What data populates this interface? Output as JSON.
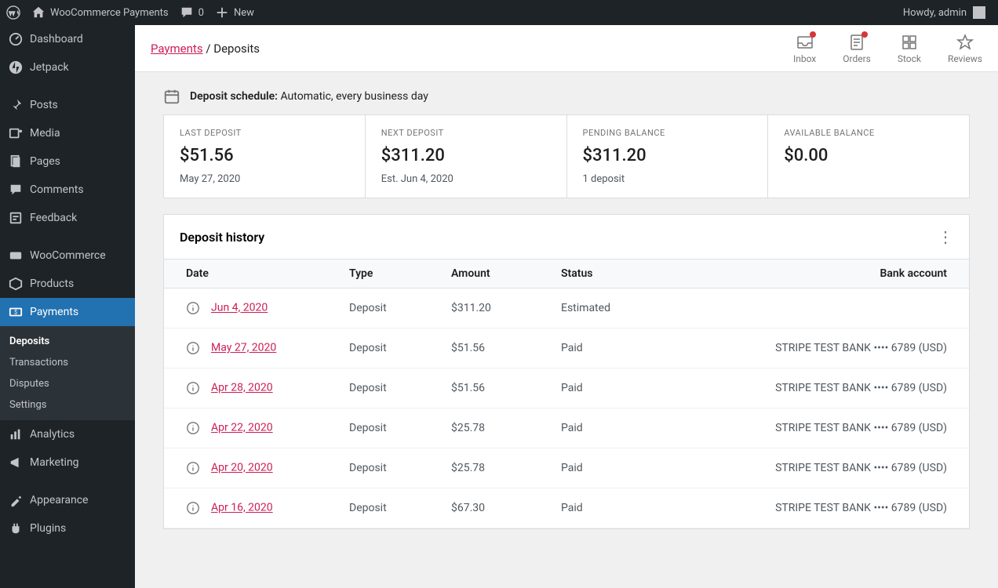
{
  "adminbar": {
    "site_name": "WooCommerce Payments",
    "comments": "0",
    "new_label": "New",
    "howdy": "Howdy, admin"
  },
  "sidebar": {
    "items": [
      {
        "label": "Dashboard"
      },
      {
        "label": "Jetpack"
      },
      {
        "label": "Posts"
      },
      {
        "label": "Media"
      },
      {
        "label": "Pages"
      },
      {
        "label": "Comments"
      },
      {
        "label": "Feedback"
      },
      {
        "label": "WooCommerce"
      },
      {
        "label": "Products"
      },
      {
        "label": "Payments"
      },
      {
        "label": "Analytics"
      },
      {
        "label": "Marketing"
      },
      {
        "label": "Appearance"
      },
      {
        "label": "Plugins"
      }
    ],
    "submenu": [
      {
        "label": "Deposits",
        "current": true
      },
      {
        "label": "Transactions"
      },
      {
        "label": "Disputes"
      },
      {
        "label": "Settings"
      }
    ]
  },
  "header": {
    "breadcrumb_parent": "Payments",
    "breadcrumb_current": "Deposits",
    "actions": [
      {
        "label": "Inbox",
        "dot": true
      },
      {
        "label": "Orders",
        "dot": true
      },
      {
        "label": "Stock",
        "dot": false
      },
      {
        "label": "Reviews",
        "dot": false
      }
    ]
  },
  "schedule": {
    "label": "Deposit schedule:",
    "value": "Automatic, every business day"
  },
  "summary": [
    {
      "label": "LAST DEPOSIT",
      "value": "$51.56",
      "sub": "May 27, 2020"
    },
    {
      "label": "NEXT DEPOSIT",
      "value": "$311.20",
      "sub": "Est. Jun 4, 2020"
    },
    {
      "label": "PENDING BALANCE",
      "value": "$311.20",
      "sub": "1 deposit"
    },
    {
      "label": "AVAILABLE BALANCE",
      "value": "$0.00",
      "sub": ""
    }
  ],
  "table": {
    "title": "Deposit history",
    "columns": [
      "Date",
      "Type",
      "Amount",
      "Status",
      "Bank account"
    ],
    "rows": [
      {
        "date": "Jun 4, 2020",
        "type": "Deposit",
        "amount": "$311.20",
        "status": "Estimated",
        "bank": ""
      },
      {
        "date": "May 27, 2020",
        "type": "Deposit",
        "amount": "$51.56",
        "status": "Paid",
        "bank": "STRIPE TEST BANK •••• 6789 (USD)"
      },
      {
        "date": "Apr 28, 2020",
        "type": "Deposit",
        "amount": "$51.56",
        "status": "Paid",
        "bank": "STRIPE TEST BANK •••• 6789 (USD)"
      },
      {
        "date": "Apr 22, 2020",
        "type": "Deposit",
        "amount": "$25.78",
        "status": "Paid",
        "bank": "STRIPE TEST BANK •••• 6789 (USD)"
      },
      {
        "date": "Apr 20, 2020",
        "type": "Deposit",
        "amount": "$25.78",
        "status": "Paid",
        "bank": "STRIPE TEST BANK •••• 6789 (USD)"
      },
      {
        "date": "Apr 16, 2020",
        "type": "Deposit",
        "amount": "$67.30",
        "status": "Paid",
        "bank": "STRIPE TEST BANK •••• 6789 (USD)"
      }
    ]
  }
}
